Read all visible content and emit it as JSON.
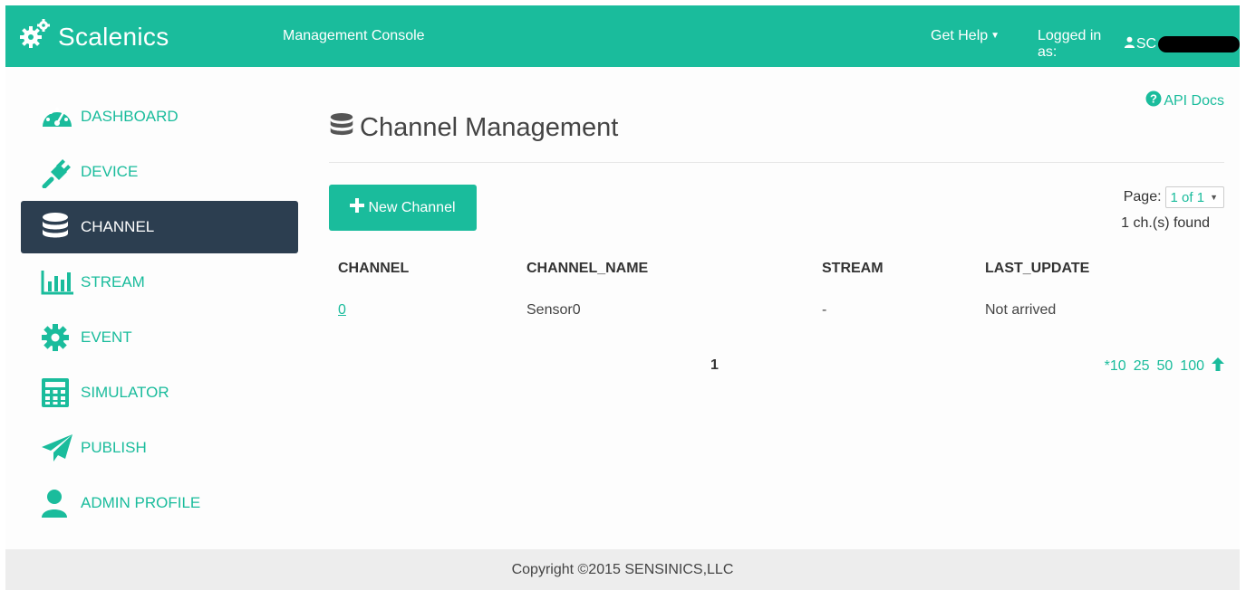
{
  "header": {
    "brand": "Scalenics",
    "title": "Management Console",
    "help_label": "Get Help",
    "logged_in_label": "Logged in as:",
    "user_partial": "SC"
  },
  "sidebar": {
    "items": [
      {
        "label": "DASHBOARD",
        "icon": "dashboard-gauge-icon"
      },
      {
        "label": "DEVICE",
        "icon": "plug-icon"
      },
      {
        "label": "CHANNEL",
        "icon": "database-icon",
        "active": true
      },
      {
        "label": "STREAM",
        "icon": "bar-chart-icon"
      },
      {
        "label": "EVENT",
        "icon": "gear-icon"
      },
      {
        "label": "SIMULATOR",
        "icon": "calculator-icon"
      },
      {
        "label": "PUBLISH",
        "icon": "paper-plane-icon"
      },
      {
        "label": "ADMIN PROFILE",
        "icon": "user-icon"
      }
    ]
  },
  "main": {
    "api_docs": "API Docs",
    "title": "Channel Management",
    "new_button": "New Channel",
    "page_label": "Page:",
    "page_value": "1 of 1",
    "found_text": "1 ch.(s) found",
    "table": {
      "headers": [
        "CHANNEL",
        "CHANNEL_NAME",
        "STREAM",
        "LAST_UPDATE"
      ],
      "rows": [
        {
          "channel": "0",
          "channel_name": "Sensor0",
          "stream": "-",
          "last_update": "Not arrived"
        }
      ]
    },
    "pagination": {
      "current": "1",
      "sizes": [
        "*10",
        "25",
        "50",
        "100"
      ]
    }
  },
  "footer": {
    "copyright": "Copyright ©2015 SENSINICS,LLC"
  },
  "colors": {
    "accent": "#1abc9c",
    "sidebar_active": "#2c3e50",
    "footer_bg": "#ededed"
  }
}
